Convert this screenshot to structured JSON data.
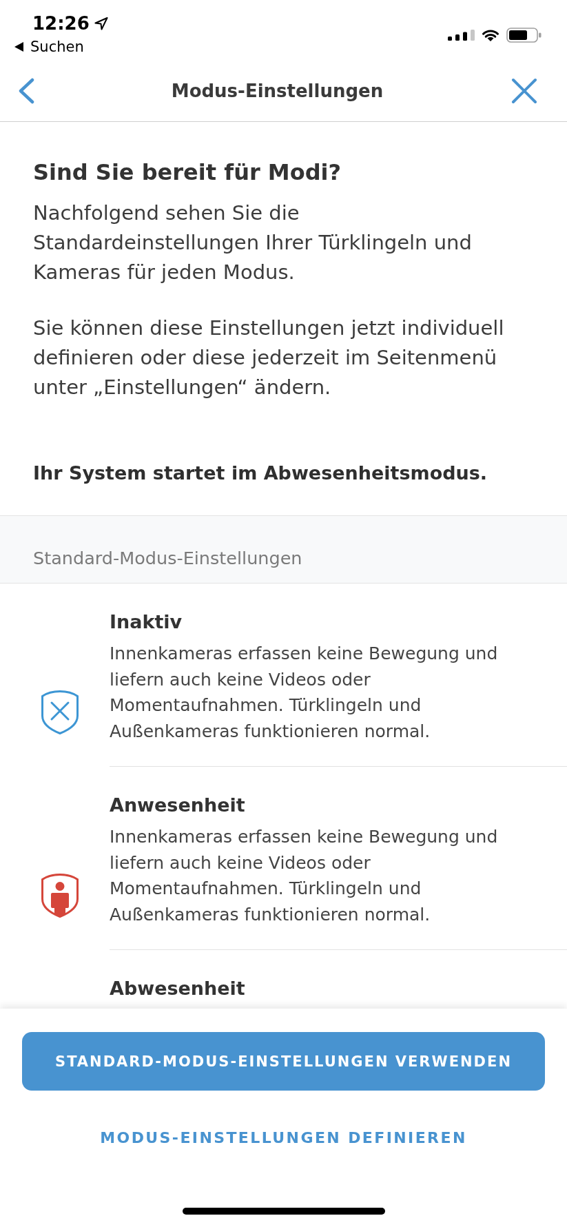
{
  "status_bar": {
    "time": "12:26",
    "back_label": "Suchen"
  },
  "nav": {
    "title": "Modus-Einstellungen"
  },
  "intro": {
    "heading": "Sind Sie bereit für Modi?",
    "paragraphs": [
      "Nachfolgend sehen Sie die Standardeinstellungen Ihrer Türklingeln und Kameras für jeden Modus.",
      "Sie können diese Einstellungen jetzt individuell definieren oder diese jederzeit im Seitenmenü unter „Einstellungen“ ändern."
    ],
    "note": "Ihr System startet im Abwesenheitsmodus."
  },
  "section": {
    "header": "Standard-Modus-Einstellungen",
    "modes": [
      {
        "kind": "inactive",
        "color": "#3d96d4",
        "title": "Inaktiv",
        "description": "Innenkameras erfassen keine Bewegung und liefern auch keine Videos oder Momentaufnahmen. Türklingeln und Außenkameras funktionieren normal."
      },
      {
        "kind": "home",
        "color": "#d5463a",
        "title": "Anwesenheit",
        "description": "Innenkameras erfassen keine Bewegung und liefern auch keine Videos oder Momentaufnahmen. Türklingeln und Außenkameras funktionieren normal."
      },
      {
        "title": "Abwesenheit"
      }
    ]
  },
  "actions": {
    "primary": "STANDARD-MODUS-EINSTELLUNGEN VERWENDEN",
    "secondary": "MODUS-EINSTELLUNGEN DEFINIEREN"
  }
}
